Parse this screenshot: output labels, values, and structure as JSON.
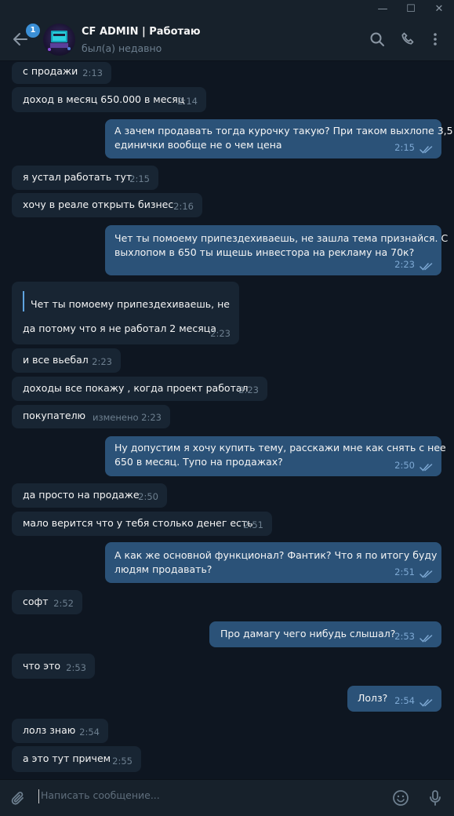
{
  "window": {
    "minimize": "—",
    "maximize": "☐",
    "close": "✕"
  },
  "header": {
    "badge": "1",
    "title": "CF ADMIN | Работаю",
    "status": "был(а) недавно"
  },
  "messages": [
    {
      "dir": "in",
      "text": "с продажи",
      "time": "2:13"
    },
    {
      "dir": "in",
      "text": "доход в месяц 650.000 в месяц",
      "time": "2:14"
    },
    {
      "dir": "out",
      "text": "А зачем продавать тогда курочку такую? При таком выхлопе 3,5\nединички вообще не о чем цена",
      "time": "2:15"
    },
    {
      "dir": "in",
      "text": "я устал работать тут",
      "time": "2:15"
    },
    {
      "dir": "in",
      "text": "хочу в реале открыть бизнес",
      "time": "2:16"
    },
    {
      "dir": "out",
      "text": "Чет ты помоему припездехиваешь, не зашла тема признайся. С\nвыхлопом в 650 ты ищешь инвестора на рекламу на 70к?",
      "time": "2:23"
    },
    {
      "dir": "in",
      "reply": "Чет ты помоему припездехиваешь, не ...",
      "text": "да потому что я не работал 2 месяца",
      "time": "2:23"
    },
    {
      "dir": "in",
      "text": "и все вьебал",
      "time": "2:23"
    },
    {
      "dir": "in",
      "text": "доходы все покажу , когда проект работал",
      "time": "2:23"
    },
    {
      "dir": "in",
      "text": "покупателю",
      "time": "изменено 2:23"
    },
    {
      "dir": "out",
      "text": "Ну допустим я хочу купить тему, расскажи мне как снять с нее\n650 в месяц. Тупо на продажах?",
      "time": "2:50"
    },
    {
      "dir": "in",
      "text": "да просто на продаже",
      "time": "2:50"
    },
    {
      "dir": "in",
      "text": "мало верится что у тебя столько денег есть",
      "time": "2:51"
    },
    {
      "dir": "out",
      "text": "А как же основной функционал? Фантик? Что я по итогу буду\nлюдям продавать?",
      "time": "2:51"
    },
    {
      "dir": "in",
      "text": "софт",
      "time": "2:52"
    },
    {
      "dir": "out",
      "text": "Про дамагу чего нибудь слышал?",
      "time": "2:53"
    },
    {
      "dir": "in",
      "text": "что это",
      "time": "2:53"
    },
    {
      "dir": "out",
      "text": "Лолз?",
      "time": "2:54"
    },
    {
      "dir": "in",
      "text": "лолз знаю",
      "time": "2:54"
    },
    {
      "dir": "in",
      "text": "а это тут причем",
      "time": "2:55"
    }
  ],
  "composer": {
    "placeholder": "Написать сообщение..."
  },
  "colors": {
    "background": "#0e1621",
    "incoming": "#182533",
    "outgoing": "#2b5278",
    "accent": "#5fa4e0"
  }
}
